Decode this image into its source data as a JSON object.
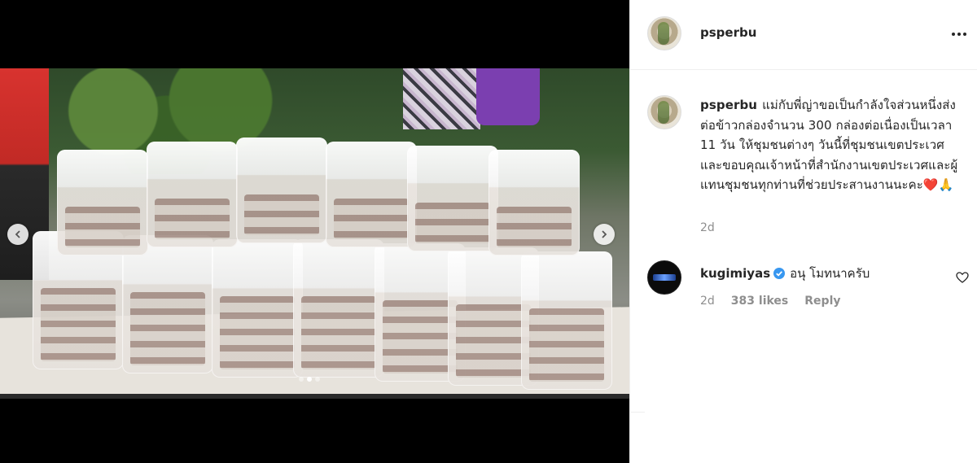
{
  "post": {
    "username": "psperbu",
    "caption_text": "แม่กับพี่ญ่าขอเป็นกำลังใจส่วนหนึ่งส่งต่อข้าวกล่องจำนวน 300 กล่องต่อเนื่องเป็นเวลา 11 วัน ให้ชุมชนต่างๆ วันนี้ที่ชุมชนเขตประเวศ และขอบคุณเจ้าหน้าที่สำนักงานเขตประเวศและผู้แทนชุมชนทุกท่านที่ช่วยประสานงานนะคะ❤️🙏",
    "time": "2d"
  },
  "media": {
    "carousel_count": 3,
    "active_index": 1
  },
  "comment": {
    "username": "kugimiyas",
    "verified": true,
    "text": "อนุ โมทนาครับ",
    "time": "2d",
    "likes": "383 likes",
    "reply_label": "Reply"
  },
  "colors": {
    "verified": "#3897f0",
    "muted_text": "#8e8e8e"
  },
  "icons": [
    "chevron-left-icon",
    "chevron-right-icon",
    "more-options-icon",
    "verified-badge-icon",
    "heart-icon"
  ]
}
